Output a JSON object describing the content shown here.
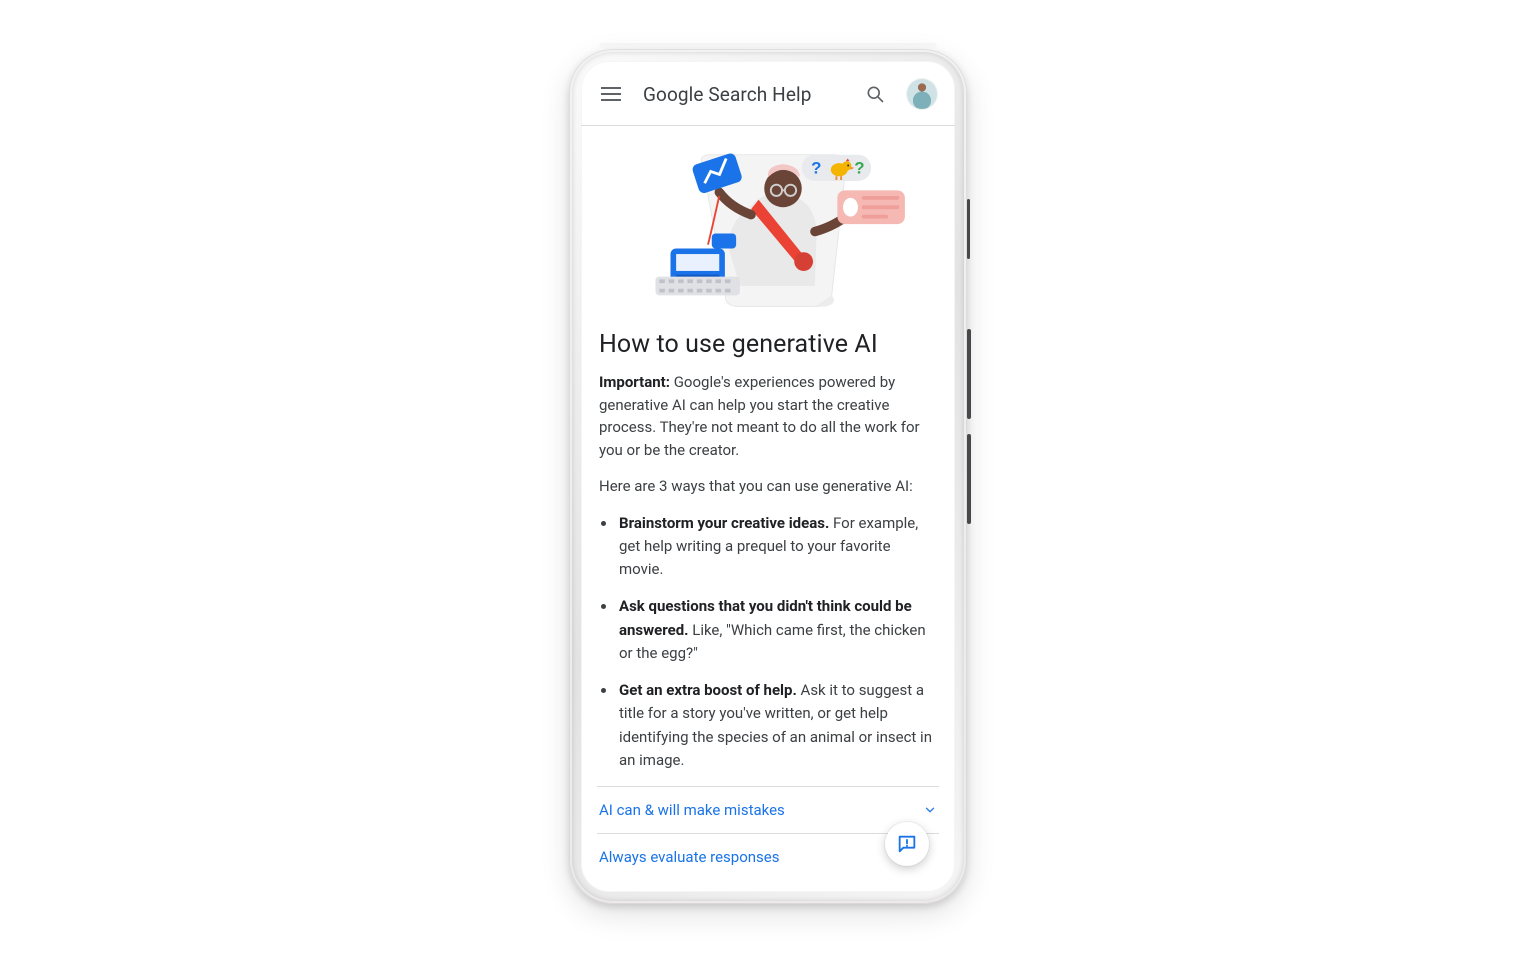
{
  "header": {
    "title": "Google Search Help"
  },
  "article": {
    "title": "How to use generative AI",
    "important_label": "Important:",
    "important_text": " Google's experiences powered by generative AI can help you start the creative process. They're not meant to do all the work for you or be the creator.",
    "lead": "Here are 3 ways that you can use generative AI:",
    "bullets": [
      {
        "strong": "Brainstorm your creative ideas.",
        "rest": " For example, get help writing a prequel to your favorite movie."
      },
      {
        "strong": "Ask questions that you didn't think could be answered.",
        "rest": " Like, \"Which came first, the chicken or the egg?\""
      },
      {
        "strong": "Get an extra boost of help.",
        "rest": " Ask it to suggest a title for a story you've written, or get help identifying the species of an animal or insect in an image."
      }
    ]
  },
  "expanders": [
    {
      "label": "AI can & will make mistakes"
    },
    {
      "label": "Always evaluate responses"
    }
  ]
}
